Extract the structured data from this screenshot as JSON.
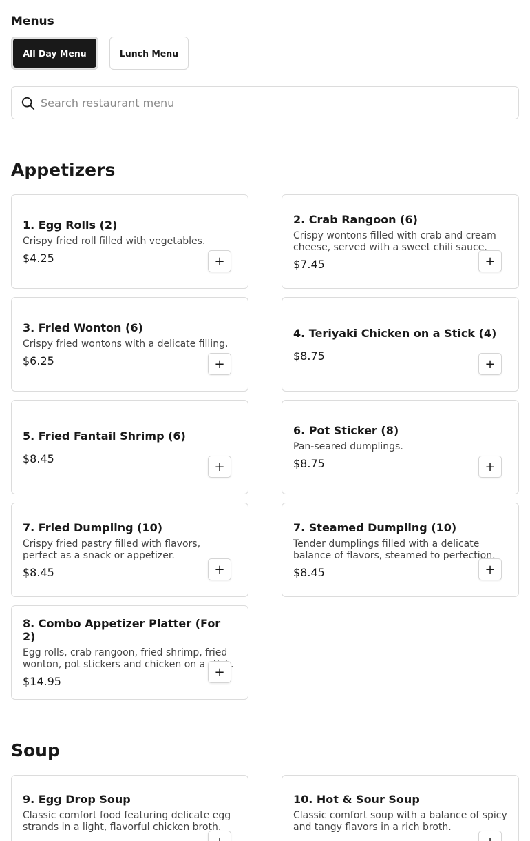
{
  "header": {
    "title": "Menus"
  },
  "tabs": [
    {
      "label": "All Day Menu",
      "active": true
    },
    {
      "label": "Lunch Menu",
      "active": false
    }
  ],
  "search": {
    "placeholder": "Search restaurant menu",
    "value": ""
  },
  "icons": {
    "search": "search-icon",
    "add": "plus-icon"
  },
  "add_symbol": "+",
  "sections": [
    {
      "title": "Appetizers",
      "items": [
        {
          "name": "1. Egg Rolls (2)",
          "description": "Crispy fried roll filled with vegetables.",
          "price": "$4.25"
        },
        {
          "name": "2. Crab Rangoon (6)",
          "description": "Crispy wontons filled with crab and cream cheese, served with a sweet chili sauce.",
          "price": "$7.45"
        },
        {
          "name": "3. Fried Wonton (6)",
          "description": "Crispy fried wontons with a delicate filling.",
          "price": "$6.25"
        },
        {
          "name": "4. Teriyaki Chicken on a Stick (4)",
          "description": "",
          "price": "$8.75"
        },
        {
          "name": "5. Fried Fantail Shrimp (6)",
          "description": "",
          "price": "$8.45"
        },
        {
          "name": "6. Pot Sticker (8)",
          "description": "Pan-seared dumplings.",
          "price": "$8.75"
        },
        {
          "name": "7. Fried Dumpling (10)",
          "description": "Crispy fried pastry filled with flavors, perfect as a snack or appetizer.",
          "price": "$8.45"
        },
        {
          "name": "7. Steamed Dumpling (10)",
          "description": "Tender dumplings filled with a delicate balance of flavors, steamed to perfection.",
          "price": "$8.45"
        },
        {
          "name": "8. Combo Appetizer Platter (For 2)",
          "description": "Egg rolls, crab rangoon, fried shrimp, fried wonton, pot stickers and chicken on a stick.",
          "price": "$14.95"
        }
      ]
    },
    {
      "title": "Soup",
      "items": [
        {
          "name": "9. Egg Drop Soup",
          "description": "Classic comfort food featuring delicate egg strands in a light, flavorful chicken broth.",
          "price": ""
        },
        {
          "name": "10. Hot & Sour Soup",
          "description": "Classic comfort soup with a balance of spicy and tangy flavors in a rich broth.",
          "price": ""
        }
      ]
    }
  ]
}
